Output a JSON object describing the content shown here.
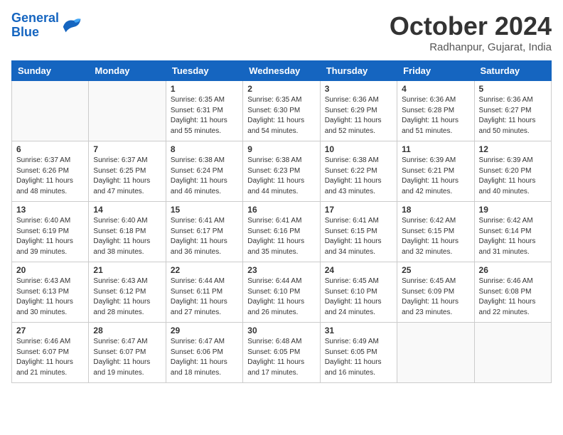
{
  "header": {
    "logo_line1": "General",
    "logo_line2": "Blue",
    "month": "October 2024",
    "location": "Radhanpur, Gujarat, India"
  },
  "weekdays": [
    "Sunday",
    "Monday",
    "Tuesday",
    "Wednesday",
    "Thursday",
    "Friday",
    "Saturday"
  ],
  "weeks": [
    [
      {
        "day": "",
        "info": ""
      },
      {
        "day": "",
        "info": ""
      },
      {
        "day": "1",
        "info": "Sunrise: 6:35 AM\nSunset: 6:31 PM\nDaylight: 11 hours and 55 minutes."
      },
      {
        "day": "2",
        "info": "Sunrise: 6:35 AM\nSunset: 6:30 PM\nDaylight: 11 hours and 54 minutes."
      },
      {
        "day": "3",
        "info": "Sunrise: 6:36 AM\nSunset: 6:29 PM\nDaylight: 11 hours and 52 minutes."
      },
      {
        "day": "4",
        "info": "Sunrise: 6:36 AM\nSunset: 6:28 PM\nDaylight: 11 hours and 51 minutes."
      },
      {
        "day": "5",
        "info": "Sunrise: 6:36 AM\nSunset: 6:27 PM\nDaylight: 11 hours and 50 minutes."
      }
    ],
    [
      {
        "day": "6",
        "info": "Sunrise: 6:37 AM\nSunset: 6:26 PM\nDaylight: 11 hours and 48 minutes."
      },
      {
        "day": "7",
        "info": "Sunrise: 6:37 AM\nSunset: 6:25 PM\nDaylight: 11 hours and 47 minutes."
      },
      {
        "day": "8",
        "info": "Sunrise: 6:38 AM\nSunset: 6:24 PM\nDaylight: 11 hours and 46 minutes."
      },
      {
        "day": "9",
        "info": "Sunrise: 6:38 AM\nSunset: 6:23 PM\nDaylight: 11 hours and 44 minutes."
      },
      {
        "day": "10",
        "info": "Sunrise: 6:38 AM\nSunset: 6:22 PM\nDaylight: 11 hours and 43 minutes."
      },
      {
        "day": "11",
        "info": "Sunrise: 6:39 AM\nSunset: 6:21 PM\nDaylight: 11 hours and 42 minutes."
      },
      {
        "day": "12",
        "info": "Sunrise: 6:39 AM\nSunset: 6:20 PM\nDaylight: 11 hours and 40 minutes."
      }
    ],
    [
      {
        "day": "13",
        "info": "Sunrise: 6:40 AM\nSunset: 6:19 PM\nDaylight: 11 hours and 39 minutes."
      },
      {
        "day": "14",
        "info": "Sunrise: 6:40 AM\nSunset: 6:18 PM\nDaylight: 11 hours and 38 minutes."
      },
      {
        "day": "15",
        "info": "Sunrise: 6:41 AM\nSunset: 6:17 PM\nDaylight: 11 hours and 36 minutes."
      },
      {
        "day": "16",
        "info": "Sunrise: 6:41 AM\nSunset: 6:16 PM\nDaylight: 11 hours and 35 minutes."
      },
      {
        "day": "17",
        "info": "Sunrise: 6:41 AM\nSunset: 6:15 PM\nDaylight: 11 hours and 34 minutes."
      },
      {
        "day": "18",
        "info": "Sunrise: 6:42 AM\nSunset: 6:15 PM\nDaylight: 11 hours and 32 minutes."
      },
      {
        "day": "19",
        "info": "Sunrise: 6:42 AM\nSunset: 6:14 PM\nDaylight: 11 hours and 31 minutes."
      }
    ],
    [
      {
        "day": "20",
        "info": "Sunrise: 6:43 AM\nSunset: 6:13 PM\nDaylight: 11 hours and 30 minutes."
      },
      {
        "day": "21",
        "info": "Sunrise: 6:43 AM\nSunset: 6:12 PM\nDaylight: 11 hours and 28 minutes."
      },
      {
        "day": "22",
        "info": "Sunrise: 6:44 AM\nSunset: 6:11 PM\nDaylight: 11 hours and 27 minutes."
      },
      {
        "day": "23",
        "info": "Sunrise: 6:44 AM\nSunset: 6:10 PM\nDaylight: 11 hours and 26 minutes."
      },
      {
        "day": "24",
        "info": "Sunrise: 6:45 AM\nSunset: 6:10 PM\nDaylight: 11 hours and 24 minutes."
      },
      {
        "day": "25",
        "info": "Sunrise: 6:45 AM\nSunset: 6:09 PM\nDaylight: 11 hours and 23 minutes."
      },
      {
        "day": "26",
        "info": "Sunrise: 6:46 AM\nSunset: 6:08 PM\nDaylight: 11 hours and 22 minutes."
      }
    ],
    [
      {
        "day": "27",
        "info": "Sunrise: 6:46 AM\nSunset: 6:07 PM\nDaylight: 11 hours and 21 minutes."
      },
      {
        "day": "28",
        "info": "Sunrise: 6:47 AM\nSunset: 6:07 PM\nDaylight: 11 hours and 19 minutes."
      },
      {
        "day": "29",
        "info": "Sunrise: 6:47 AM\nSunset: 6:06 PM\nDaylight: 11 hours and 18 minutes."
      },
      {
        "day": "30",
        "info": "Sunrise: 6:48 AM\nSunset: 6:05 PM\nDaylight: 11 hours and 17 minutes."
      },
      {
        "day": "31",
        "info": "Sunrise: 6:49 AM\nSunset: 6:05 PM\nDaylight: 11 hours and 16 minutes."
      },
      {
        "day": "",
        "info": ""
      },
      {
        "day": "",
        "info": ""
      }
    ]
  ]
}
